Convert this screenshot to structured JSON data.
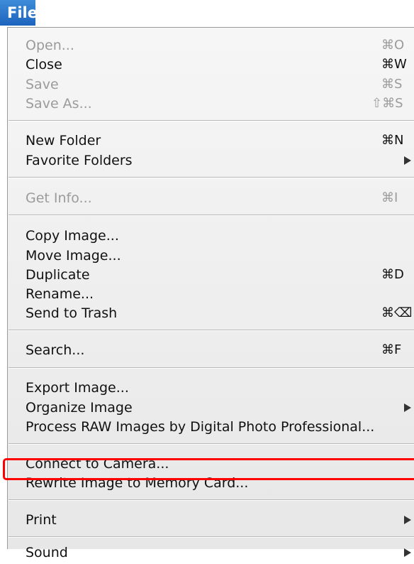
{
  "menubar": {
    "title": "File"
  },
  "colors": {
    "accent": "#1d63be",
    "highlight": "#ff0000"
  },
  "items": [
    {
      "label": "Open...",
      "shortcut": "⌘O",
      "enabled": false
    },
    {
      "label": "Close",
      "shortcut": "⌘W",
      "enabled": true
    },
    {
      "label": "Save",
      "shortcut": "⌘S",
      "enabled": false
    },
    {
      "label": "Save As...",
      "shortcut": "⇧⌘S",
      "enabled": false
    },
    {
      "label": "New Folder",
      "shortcut": "⌘N",
      "enabled": true
    },
    {
      "label": "Favorite Folders",
      "submenu": true,
      "enabled": true
    },
    {
      "label": "Get Info...",
      "shortcut": "⌘I",
      "enabled": false
    },
    {
      "label": "Copy Image...",
      "enabled": true
    },
    {
      "label": "Move Image...",
      "enabled": true
    },
    {
      "label": "Duplicate",
      "shortcut": "⌘D",
      "enabled": true
    },
    {
      "label": "Rename...",
      "enabled": true
    },
    {
      "label": "Send to Trash",
      "shortcut": "⌘⌫",
      "enabled": true
    },
    {
      "label": "Search...",
      "shortcut": "⌘F",
      "enabled": true
    },
    {
      "label": "Export Image...",
      "enabled": true
    },
    {
      "label": "Organize Image",
      "submenu": true,
      "enabled": true
    },
    {
      "label": "Process RAW Images by Digital Photo Professional...",
      "enabled": true
    },
    {
      "label": "Connect to Camera...",
      "enabled": true
    },
    {
      "label": "Rewrite Image to Memory Card...",
      "enabled": true,
      "highlighted": true
    },
    {
      "label": "Print",
      "submenu": true,
      "enabled": true
    },
    {
      "label": "Sound",
      "submenu": true,
      "enabled": true
    }
  ]
}
